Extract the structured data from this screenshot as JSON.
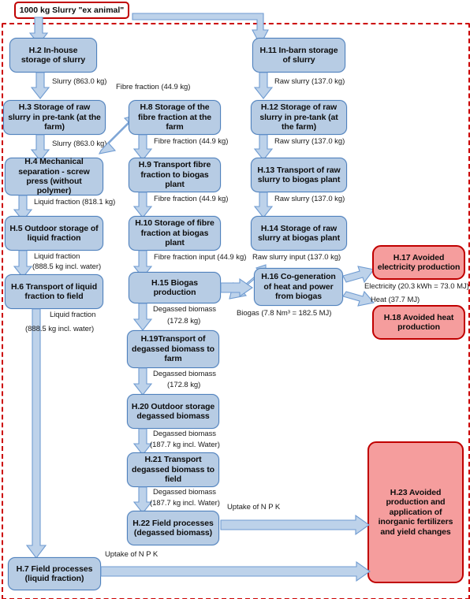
{
  "diagram": {
    "title_box": "1000 kg Slurry \"ex animal\"",
    "colors": {
      "box_fill_blue": "#b7cce4",
      "box_border_blue": "#4f81bd",
      "box_fill_red": "#f59d9d",
      "box_border_red": "#c00000",
      "boundary": "#cc0000",
      "arrow_fill": "#bdd2ea",
      "arrow_stroke": "#6f9bd1"
    },
    "nodes": [
      {
        "id": "H.2",
        "label": "H.2 In-house storage of slurry",
        "type": "process"
      },
      {
        "id": "H.3",
        "label": "H.3 Storage of raw slurry in pre-tank (at the farm)",
        "type": "process"
      },
      {
        "id": "H.4",
        "label": "H.4 Mechanical separation - screw press (without polymer)",
        "type": "process"
      },
      {
        "id": "H.5",
        "label": "H.5 Outdoor storage of liquid fraction",
        "type": "process"
      },
      {
        "id": "H.6",
        "label": "H.6 Transport of liquid fraction to field",
        "type": "process"
      },
      {
        "id": "H.7",
        "label": "H.7 Field processes (liquid fraction)",
        "type": "process"
      },
      {
        "id": "H.8",
        "label": "H.8 Storage of the fibre fraction at the farm",
        "type": "process"
      },
      {
        "id": "H.9",
        "label": "H.9 Transport fibre fraction to biogas plant",
        "type": "process"
      },
      {
        "id": "H.10",
        "label": "H.10 Storage of fibre fraction at biogas plant",
        "type": "process"
      },
      {
        "id": "H.11",
        "label": "H.11 In-barn storage of slurry",
        "type": "process"
      },
      {
        "id": "H.12",
        "label": "H.12 Storage of raw slurry in pre-tank (at the farm)",
        "type": "process"
      },
      {
        "id": "H.13",
        "label": "H.13 Transport of raw slurry to biogas plant",
        "type": "process"
      },
      {
        "id": "H.14",
        "label": "H.14 Storage of raw slurry at biogas plant",
        "type": "process"
      },
      {
        "id": "H.15",
        "label": "H.15 Biogas production",
        "type": "process"
      },
      {
        "id": "H.16",
        "label": "H.16 Co-generation of heat and power from biogas",
        "type": "process"
      },
      {
        "id": "H.17",
        "label": "H.17 Avoided electricity production",
        "type": "avoided"
      },
      {
        "id": "H.18",
        "label": "H.18 Avoided heat production",
        "type": "avoided"
      },
      {
        "id": "H.19",
        "label": "H.19Transport of degassed biomass to farm",
        "type": "process"
      },
      {
        "id": "H.20",
        "label": "H.20 Outdoor storage degassed biomass",
        "type": "process"
      },
      {
        "id": "H.21",
        "label": "H.21 Transport degassed biomass to field",
        "type": "process"
      },
      {
        "id": "H.22",
        "label": "H.22 Field processes (degassed biomass)",
        "type": "process"
      },
      {
        "id": "H.23",
        "label": "H.23 Avoided production and application of inorganic fertilizers and yield changes",
        "type": "avoided"
      }
    ],
    "flows": [
      {
        "from": "H.2",
        "to": "H.3",
        "label": "Slurry (863.0 kg)"
      },
      {
        "from": "H.3",
        "to": "H.4",
        "label": "Slurry (863.0 kg)"
      },
      {
        "from": "H.4",
        "to": "H.5",
        "label": "Liquid fraction (818.1 kg)"
      },
      {
        "from": "H.5",
        "to": "H.6",
        "label_line1": "Liquid fraction",
        "label_line2": "(888.5 kg incl. water)"
      },
      {
        "from": "H.6",
        "to": "H.7",
        "label_line1": "Liquid fraction",
        "label_line2": "(888.5 kg incl. water)"
      },
      {
        "from": "H.4",
        "to": "H.8",
        "label": "Fibre fraction (44.9 kg)"
      },
      {
        "from": "H.8",
        "to": "H.9",
        "label": "Fibre fraction (44.9 kg)"
      },
      {
        "from": "H.9",
        "to": "H.10",
        "label": "Fibre fraction (44.9 kg)"
      },
      {
        "from": "H.10",
        "to": "H.15",
        "label": "Fibre fraction input (44.9 kg)"
      },
      {
        "from": "H.11",
        "to": "H.12",
        "label": "Raw slurry (137.0 kg)"
      },
      {
        "from": "H.12",
        "to": "H.13",
        "label": "Raw slurry (137.0 kg)"
      },
      {
        "from": "H.13",
        "to": "H.14",
        "label": "Raw slurry (137.0 kg)"
      },
      {
        "from": "H.14",
        "to": "H.15",
        "label": "Raw slurry input (137.0 kg)"
      },
      {
        "from": "H.15",
        "to": "H.16",
        "label": "Biogas (7.8 Nm³ = 182.5 MJ)"
      },
      {
        "from": "H.16",
        "to": "H.17",
        "label": "Electricity (20.3 kWh = 73.0 MJ)"
      },
      {
        "from": "H.16",
        "to": "H.18",
        "label": "Heat (37.7 MJ)"
      },
      {
        "from": "H.15",
        "to": "H.19",
        "label_line1": "Degassed biomass",
        "label_line2": "(172.8 kg)"
      },
      {
        "from": "H.19",
        "to": "H.20",
        "label_line1": "Degassed biomass",
        "label_line2": "(172.8 kg)"
      },
      {
        "from": "H.20",
        "to": "H.21",
        "label_line1": "Degassed biomass",
        "label_line2": "(187.7 kg incl. Water)"
      },
      {
        "from": "H.21",
        "to": "H.22",
        "label_line1": "Degassed biomass",
        "label_line2": "(187.7 kg incl. Water)"
      },
      {
        "from": "H.22",
        "to": "H.23",
        "label": "Uptake of N P K"
      },
      {
        "from": "H.7",
        "to": "H.23",
        "label": "Uptake of N P K"
      }
    ],
    "labels": {
      "slurry_863_a": "Slurry (863.0 kg)",
      "slurry_863_b": "Slurry (863.0 kg)",
      "liquid_818": "Liquid fraction (818.1 kg)",
      "liquid_l1_a": "Liquid fraction",
      "liquid_l2_a": "(888.5 kg incl. water)",
      "liquid_l1_b": "Liquid fraction",
      "liquid_l2_b": "(888.5 kg incl. water)",
      "fibre_top": "Fibre fraction (44.9 kg)",
      "fibre_8_9": "Fibre fraction (44.9 kg)",
      "fibre_9_10": "Fibre fraction (44.9 kg)",
      "fibre_input": "Fibre fraction input (44.9 kg)",
      "raw_11_12": "Raw slurry (137.0 kg)",
      "raw_12_13": "Raw slurry (137.0 kg)",
      "raw_13_14": "Raw slurry (137.0 kg)",
      "raw_input": "Raw slurry input (137.0 kg)",
      "biogas": "Biogas (7.8 Nm³ = 182.5 MJ)",
      "electricity": "Electricity (20.3 kWh = 73.0 MJ)",
      "heat": "Heat (37.7 MJ)",
      "deg_l1_a": "Degassed biomass",
      "deg_l2_a": "(172.8 kg)",
      "deg_l1_b": "Degassed biomass",
      "deg_l2_b": "(172.8 kg)",
      "deg_l1_c": "Degassed biomass",
      "deg_l2_c": "(187.7 kg incl. Water)",
      "deg_l1_d": "Degassed biomass",
      "deg_l2_d": "(187.7 kg incl. Water)",
      "npk_22": "Uptake of N P K",
      "npk_7": "Uptake of N P K"
    }
  }
}
